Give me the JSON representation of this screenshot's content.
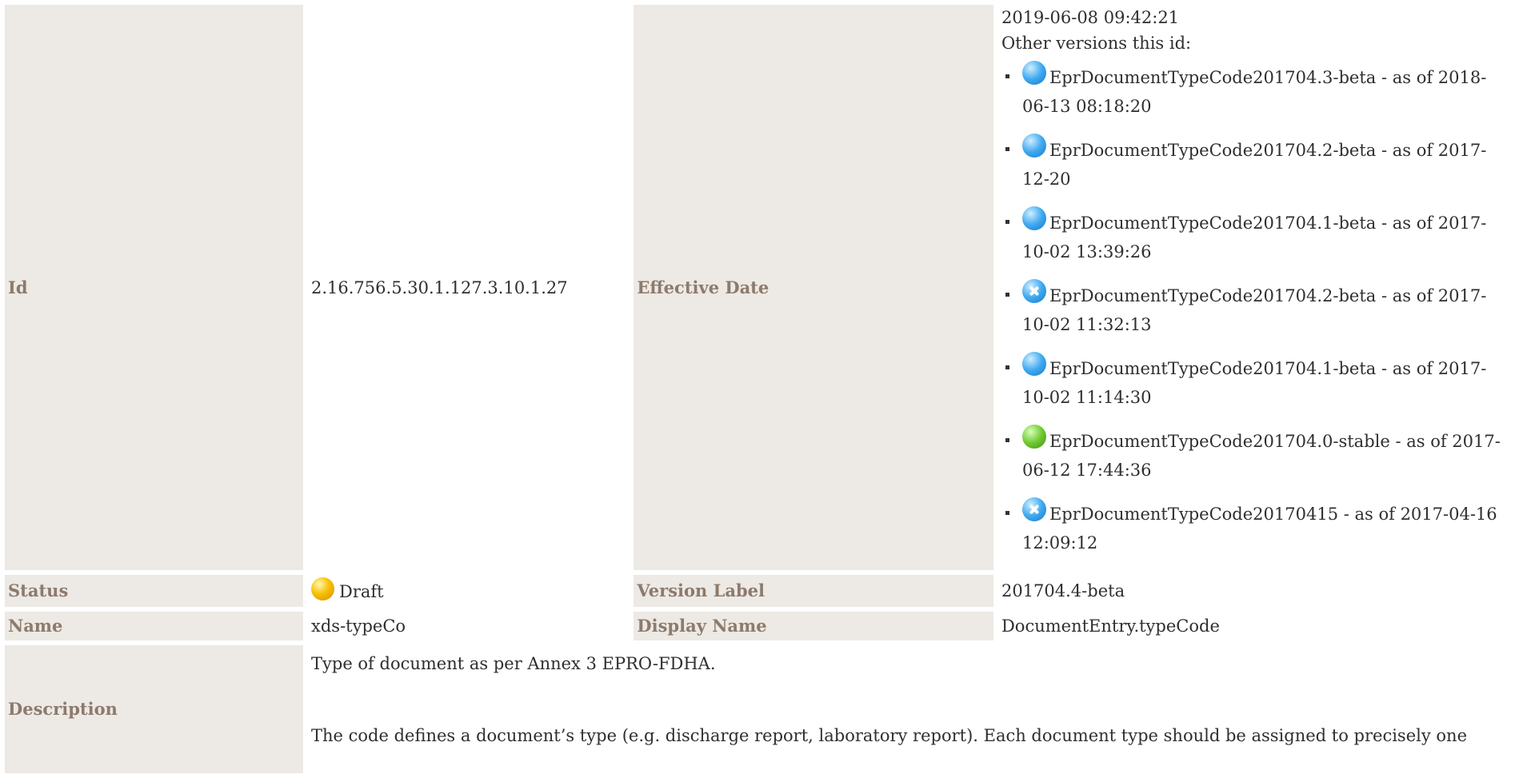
{
  "properties": {
    "id_label": "Id",
    "id_value": "2.16.756.5.30.1.127.3.10.1.27",
    "effective_date_label": "Effective Date",
    "effective_date_value": "2019-06-08 09:42:21",
    "other_versions_label": "Other versions this id:",
    "other_versions": [
      {
        "icon": "blue-ball-icon",
        "text": "EprDocumentTypeCode201704.3-beta - as of 2018-06-13 08:18:20"
      },
      {
        "icon": "blue-ball-icon",
        "text": "EprDocumentTypeCode201704.2-beta - as of 2017-12-20"
      },
      {
        "icon": "blue-ball-icon",
        "text": "EprDocumentTypeCode201704.1-beta - as of 2017-10-02 13:39:26"
      },
      {
        "icon": "cancelled-icon",
        "text": "EprDocumentTypeCode201704.2-beta - as of 2017-10-02 11:32:13"
      },
      {
        "icon": "blue-ball-icon",
        "text": "EprDocumentTypeCode201704.1-beta - as of 2017-10-02 11:14:30"
      },
      {
        "icon": "green-ball-icon",
        "text": "EprDocumentTypeCode201704.0-stable - as of 2017-06-12 17:44:36"
      },
      {
        "icon": "cancelled-icon",
        "text": "EprDocumentTypeCode20170415 - as of 2017-04-16 12:09:12"
      }
    ],
    "status_label": "Status",
    "status_icon": "yellow-ball-icon",
    "status_value": "Draft",
    "version_label_label": "Version Label",
    "version_label_value": "201704.4-beta",
    "name_label": "Name",
    "name_value": "xds-typeCo",
    "display_name_label": "Display Name",
    "display_name_value": "DocumentEntry.typeCode",
    "description_label": "Description",
    "description_p1": "Type of document as per Annex 3  EPRO-FDHA.",
    "description_p2": "The code defines a document’s type (e.g. discharge report, laboratory report). Each document type should be assigned to precisely one"
  }
}
